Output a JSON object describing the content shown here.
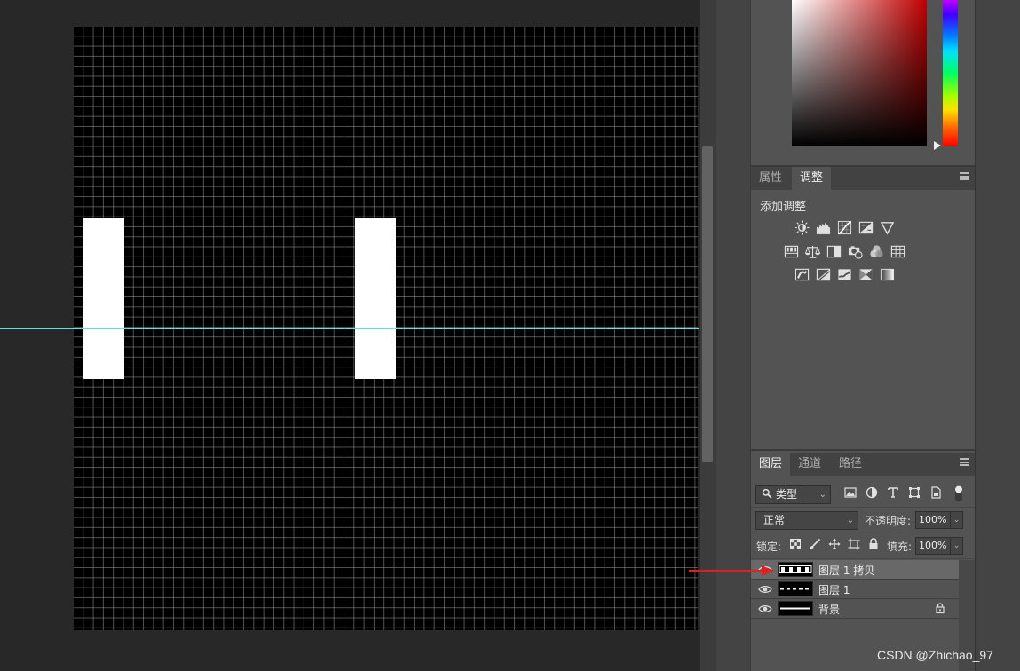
{
  "adjust_panel": {
    "tabs": [
      "属性",
      "调整"
    ],
    "active_tab": 1,
    "title": "添加调整",
    "icons_row1": [
      "brightness-contrast-icon",
      "levels-icon",
      "curves-icon",
      "exposure-icon",
      "vibrance-icon"
    ],
    "icons_row2": [
      "hue-saturation-icon",
      "color-balance-icon",
      "black-white-icon",
      "photo-filter-icon",
      "channel-mixer-icon",
      "color-lookup-icon"
    ],
    "icons_row3": [
      "invert-icon",
      "posterize-icon",
      "threshold-icon",
      "selective-color-icon",
      "gradient-map-icon"
    ]
  },
  "layers_panel": {
    "tabs": [
      "图层",
      "通道",
      "路径"
    ],
    "active_tab": 0,
    "filter_kind": "类型",
    "blend_mode": "正常",
    "opacity_label": "不透明度:",
    "opacity_value": "100%",
    "lock_label": "锁定:",
    "fill_label": "填充:",
    "fill_value": "100%",
    "layers": [
      {
        "name": "图层 1 拷贝",
        "selected": true,
        "locked": false
      },
      {
        "name": "图层 1",
        "selected": false,
        "locked": false
      },
      {
        "name": "背景",
        "selected": false,
        "locked": true
      }
    ]
  },
  "colors": {
    "guide": "#5fe0e6",
    "annotation_arrow": "#e02020",
    "canvas": "#000000",
    "shape_fill": "#ffffff"
  },
  "watermark": "CSDN @Zhichao_97"
}
